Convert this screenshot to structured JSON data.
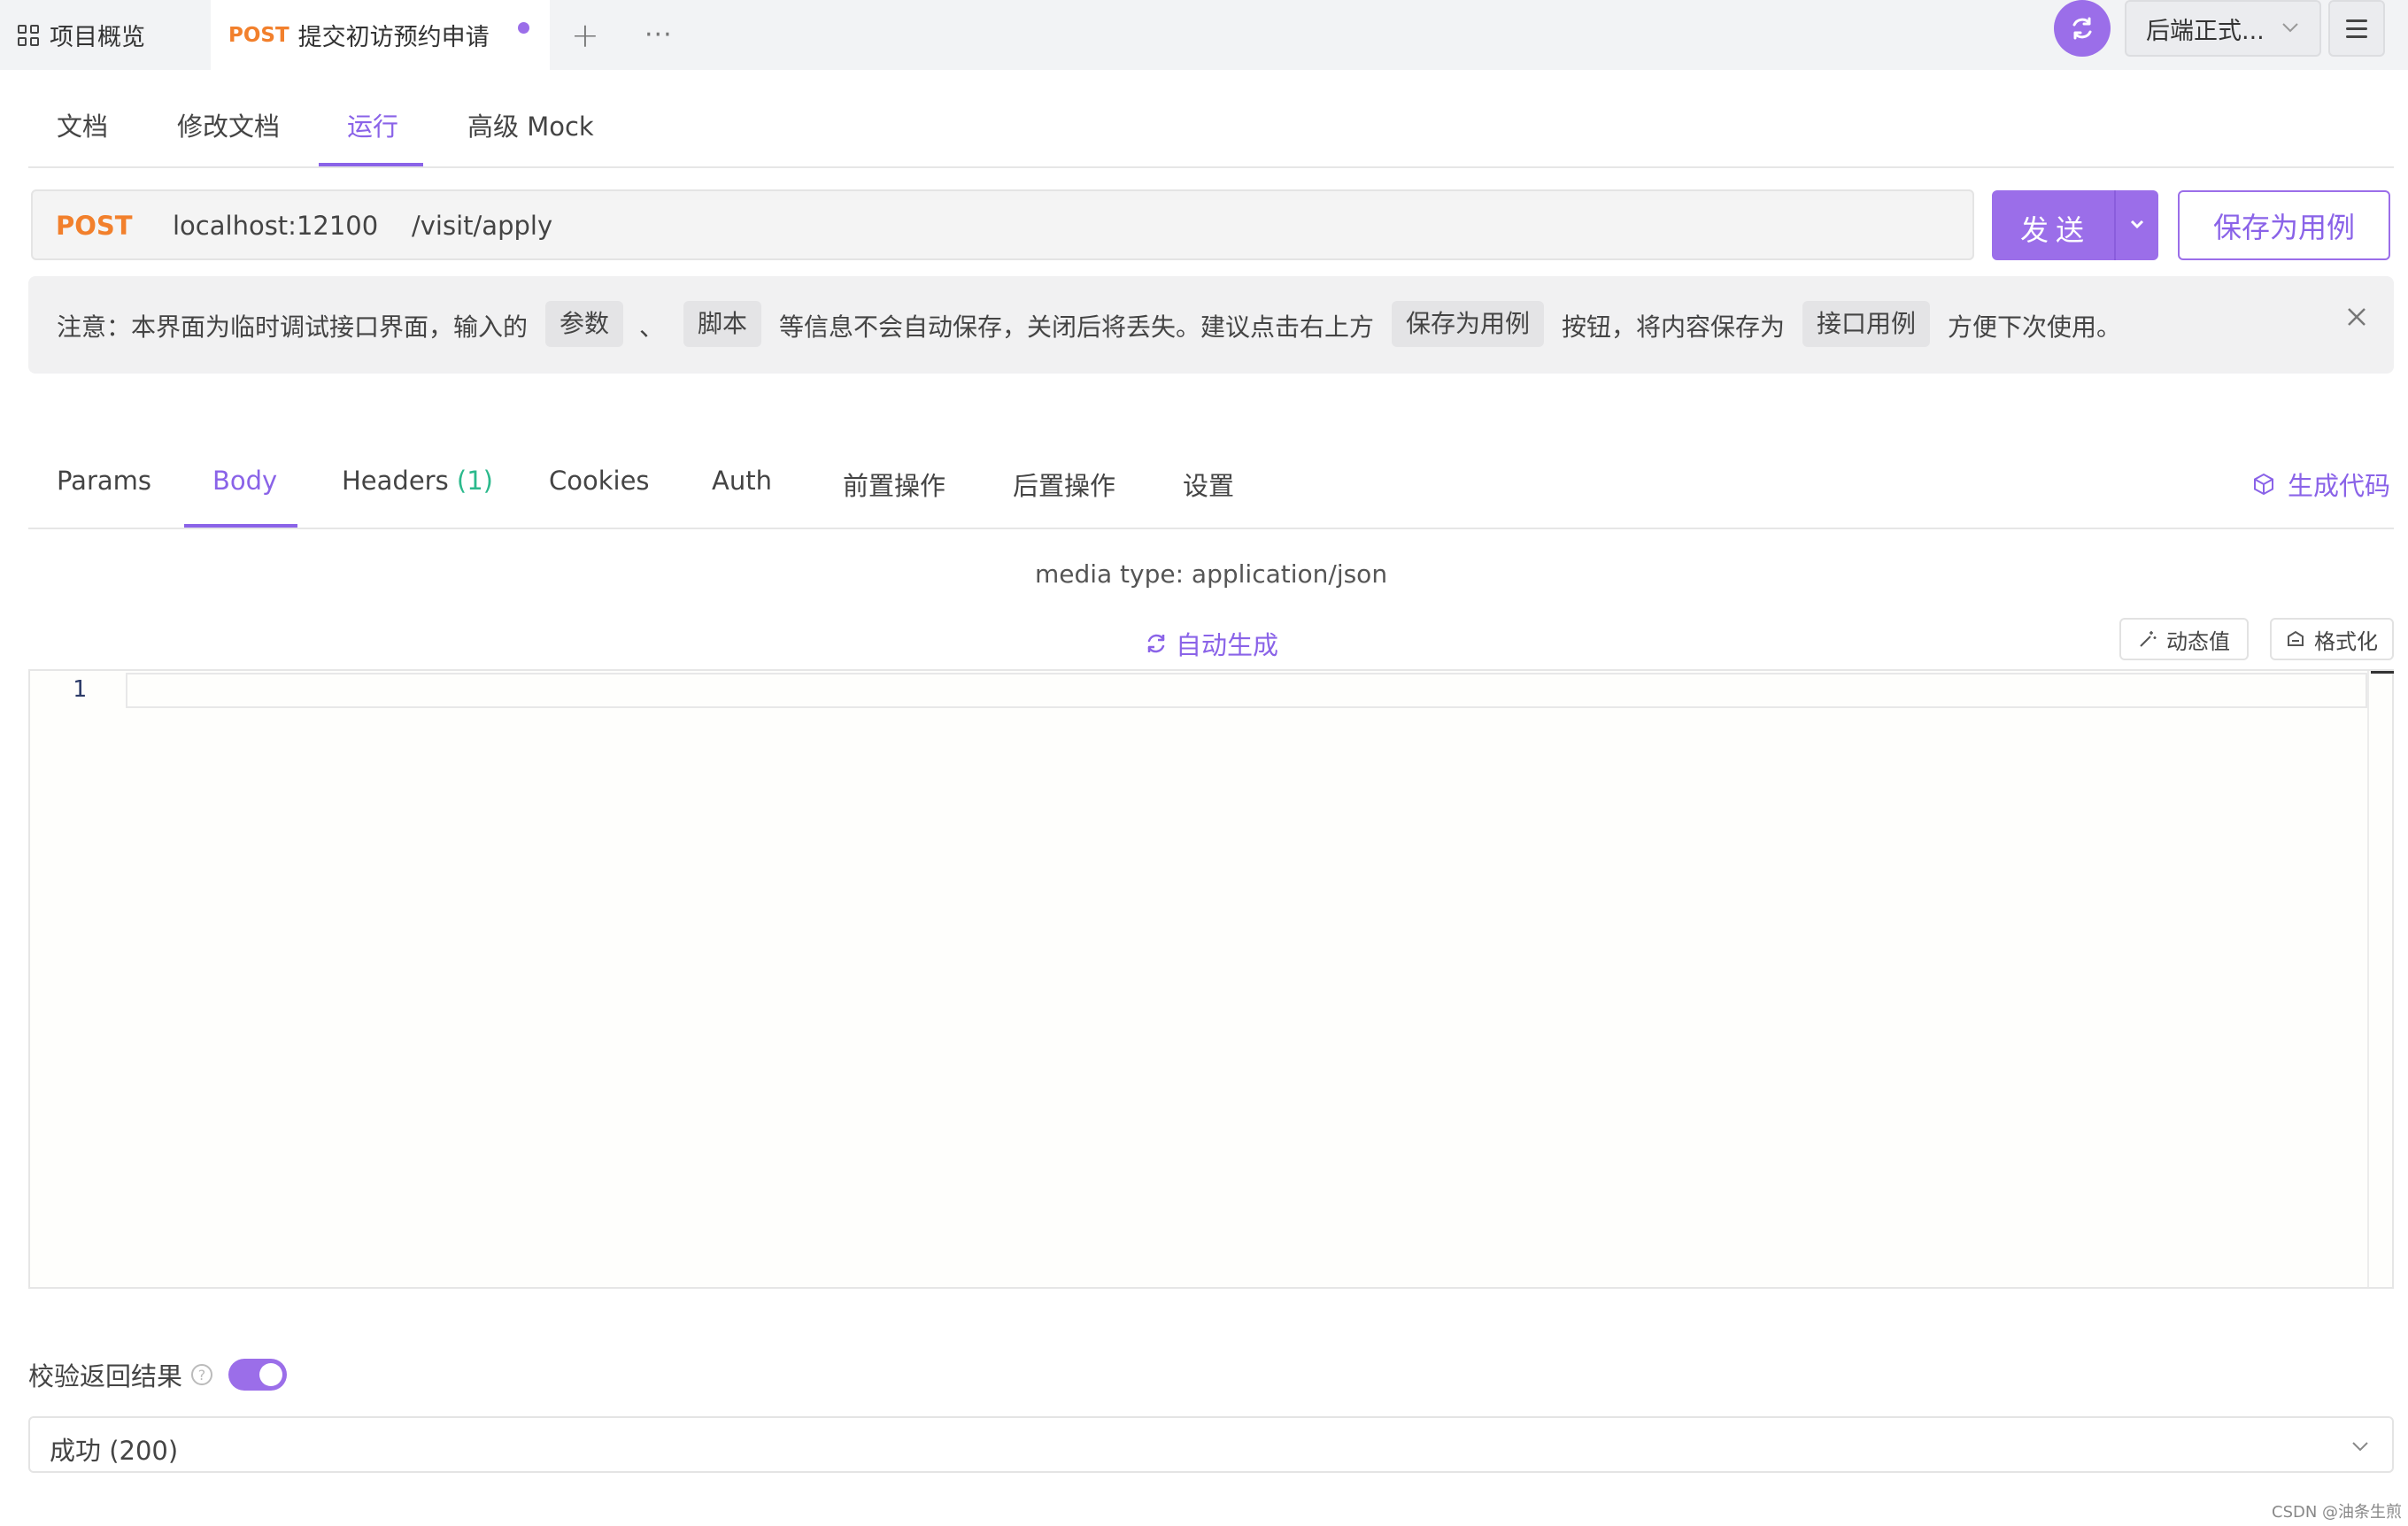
{
  "top_tabs": {
    "overview_label": "项目概览",
    "api_tab": {
      "method": "POST",
      "title": "提交初访预约申请"
    },
    "add_symbol": "+",
    "more_symbol": "···"
  },
  "top_right": {
    "environment": "后端正式..."
  },
  "sub_tabs": [
    "文档",
    "修改文档",
    "运行",
    "高级 Mock"
  ],
  "sub_tab_active": "运行",
  "request": {
    "method": "POST",
    "host": "localhost:12100",
    "path": "/visit/apply",
    "send_label": "发送",
    "save_case_label": "保存为用例"
  },
  "notice": {
    "part1": "注意：本界面为临时调试接口界面，输入的",
    "chip1": "参数",
    "sep": "、",
    "chip2": "脚本",
    "part2": "等信息不会自动保存，关闭后将丢失。建议点击右上方",
    "chip3": "保存为用例",
    "part3": "按钮，将内容保存为",
    "chip4": "接口用例",
    "part4": "方便下次使用。"
  },
  "body_tabs": {
    "params": "Params",
    "body": "Body",
    "headers": "Headers",
    "headers_count": "(1)",
    "cookies": "Cookies",
    "auth": "Auth",
    "pre": "前置操作",
    "post": "后置操作",
    "settings": "设置",
    "active": "Body"
  },
  "generate_code_label": "生成代码",
  "media_type": "media type: application/json",
  "auto_generate_label": "自动生成",
  "dynamic_value_label": "动态值",
  "format_label": "格式化",
  "editor": {
    "line_numbers": [
      "1"
    ],
    "content": ""
  },
  "validate": {
    "label": "校验返回结果",
    "help": "?",
    "enabled": true,
    "selected_result": "成功 (200)"
  },
  "watermark": "CSDN @油条生煎",
  "colors": {
    "accent": "#9b6ee9",
    "method_post": "#f2802c",
    "count_green": "#2bb98c"
  }
}
